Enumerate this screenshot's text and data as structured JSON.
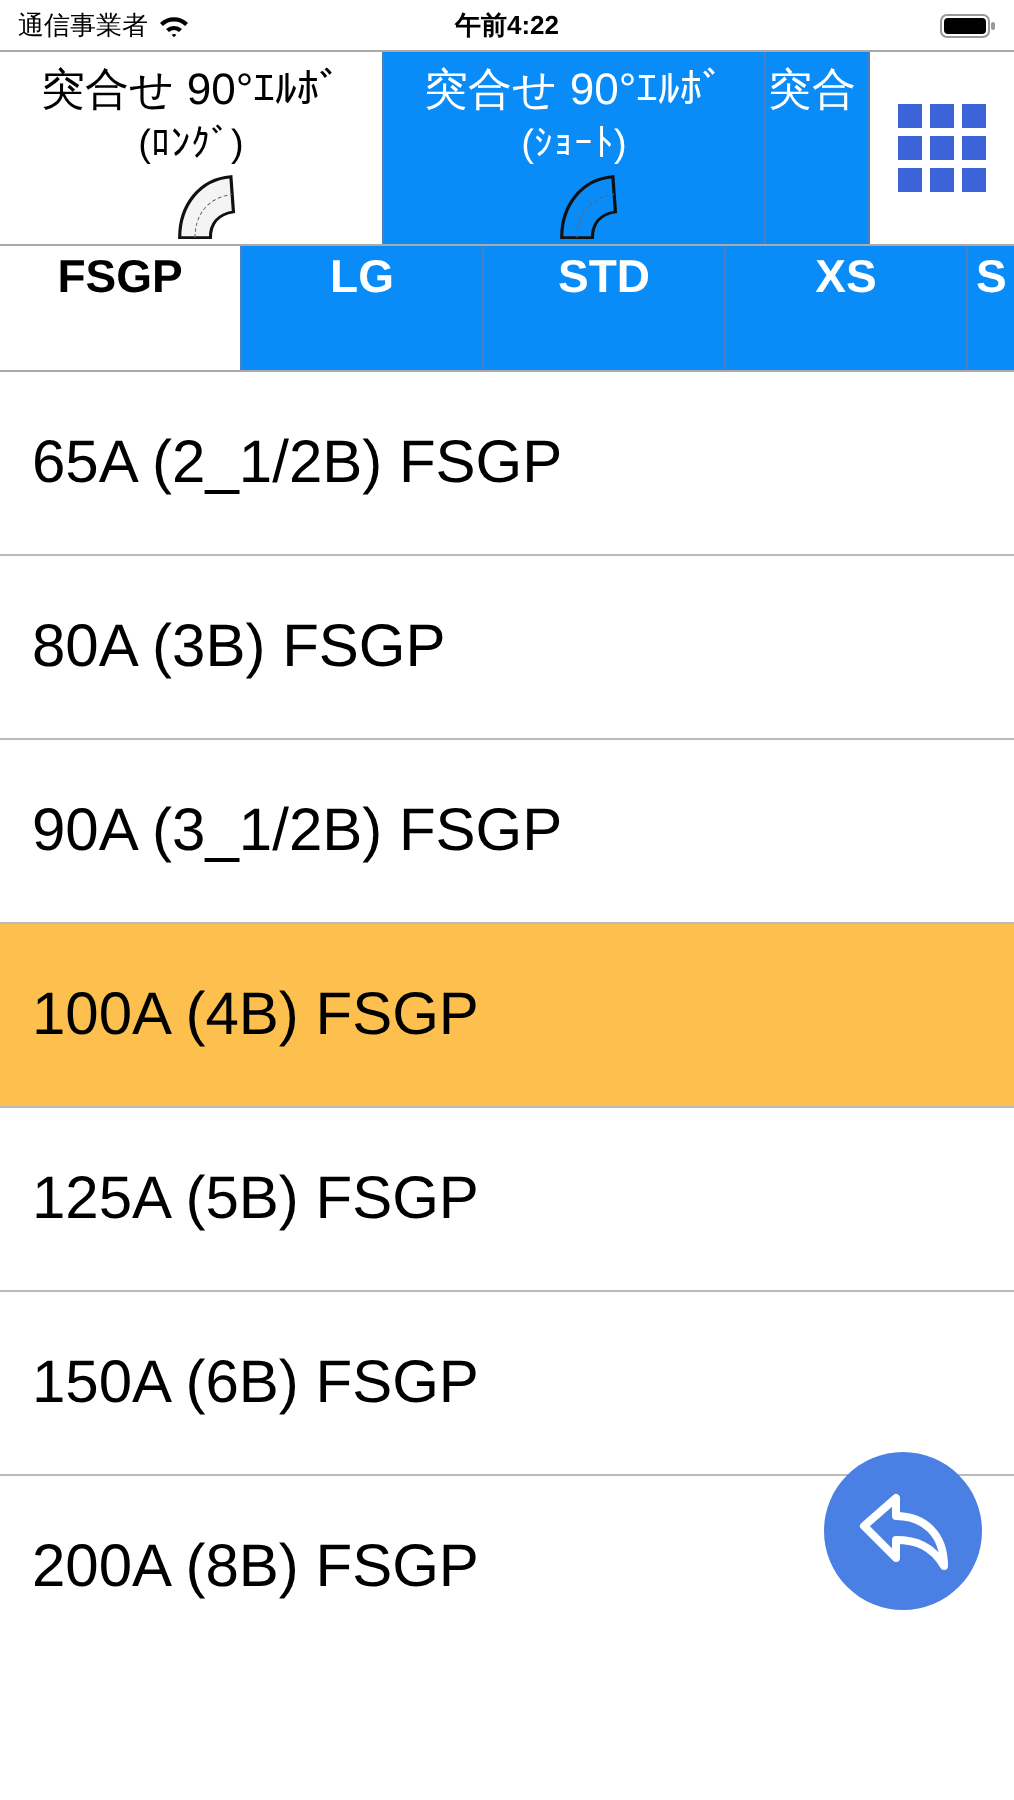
{
  "status_bar": {
    "carrier": "通信事業者",
    "time": "午前4:22"
  },
  "fitting_tabs": [
    {
      "title": "突合せ 90°ｴﾙﾎﾞ",
      "subtitle": "(ﾛﾝｸﾞ)",
      "selected": true
    },
    {
      "title": "突合せ 90°ｴﾙﾎﾞ",
      "subtitle": "(ｼｮｰﾄ)",
      "selected": false
    },
    {
      "title": "突合",
      "selected": false
    }
  ],
  "schedule_tabs": [
    {
      "label": "FSGP",
      "selected": true
    },
    {
      "label": "LG",
      "selected": false
    },
    {
      "label": "STD",
      "selected": false
    },
    {
      "label": "XS",
      "selected": false
    },
    {
      "label": "S",
      "selected": false
    }
  ],
  "sizes": [
    {
      "label": "65A (2_1/2B) FSGP",
      "selected": false
    },
    {
      "label": "80A (3B) FSGP",
      "selected": false
    },
    {
      "label": "90A (3_1/2B) FSGP",
      "selected": false
    },
    {
      "label": "100A (4B) FSGP",
      "selected": true
    },
    {
      "label": "125A (5B) FSGP",
      "selected": false
    },
    {
      "label": "150A (6B) FSGP",
      "selected": false
    },
    {
      "label": "200A (8B) FSGP",
      "selected": false
    }
  ]
}
